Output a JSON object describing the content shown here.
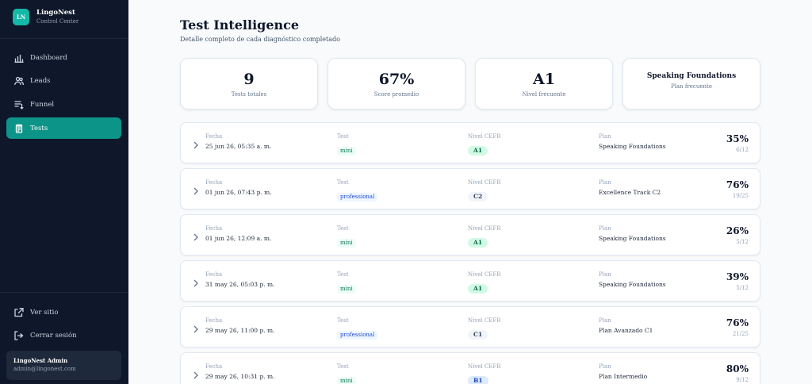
{
  "brand": {
    "logo": "LN",
    "name": "LingoNest",
    "subtitle": "Control Center"
  },
  "nav": [
    {
      "label": "Dashboard",
      "icon": "bar-chart-icon",
      "active": false
    },
    {
      "label": "Leads",
      "icon": "users-icon",
      "active": false
    },
    {
      "label": "Funnel",
      "icon": "funnel-list-icon",
      "active": false
    },
    {
      "label": "Tests",
      "icon": "clipboard-icon",
      "active": true
    }
  ],
  "footer_nav": [
    {
      "label": "Ver sitio",
      "icon": "external-link-icon"
    },
    {
      "label": "Cerrar sesión",
      "icon": "logout-icon"
    }
  ],
  "admin": {
    "name": "LingoNest Admin",
    "email": "admin@lingonest.com"
  },
  "page": {
    "title": "Test Intelligence",
    "subtitle": "Detalle completo de cada diagnóstico completado"
  },
  "stats": [
    {
      "value": "9",
      "label": "Tests totales"
    },
    {
      "value": "67%",
      "label": "Score promedio"
    },
    {
      "value": "A1",
      "label": "Nivel frecuente"
    },
    {
      "value": "Speaking Foundations",
      "label": "Plan frecuente"
    }
  ],
  "columns": {
    "date": "Fecha",
    "test": "Test",
    "level": "Nivel CEFR",
    "plan": "Plan"
  },
  "rows": [
    {
      "date": "25 jun 26, 05:35 a. m.",
      "test": "mini",
      "level": "A1",
      "plan": "Speaking Foundations",
      "score": "35%",
      "fraction": "6/12"
    },
    {
      "date": "01 jun 26, 07:43 p. m.",
      "test": "professional",
      "level": "C2",
      "plan": "Excellence Track C2",
      "score": "76%",
      "fraction": "19/25"
    },
    {
      "date": "01 jun 26, 12:09 a. m.",
      "test": "mini",
      "level": "A1",
      "plan": "Speaking Foundations",
      "score": "26%",
      "fraction": "5/12"
    },
    {
      "date": "31 may 26, 05:03 p. m.",
      "test": "mini",
      "level": "A1",
      "plan": "Speaking Foundations",
      "score": "39%",
      "fraction": "5/12"
    },
    {
      "date": "29 may 26, 11:00 p. m.",
      "test": "professional",
      "level": "C1",
      "plan": "Plan Avanzado C1",
      "score": "76%",
      "fraction": "21/25"
    },
    {
      "date": "29 may 26, 10:31 p. m.",
      "test": "mini",
      "level": "B1",
      "plan": "Plan Intermedio",
      "score": "80%",
      "fraction": "9/12"
    }
  ],
  "colors": {
    "sidebar_bg": "#0f172a",
    "accent": "#0d9488",
    "page_bg": "#f8fafc"
  }
}
